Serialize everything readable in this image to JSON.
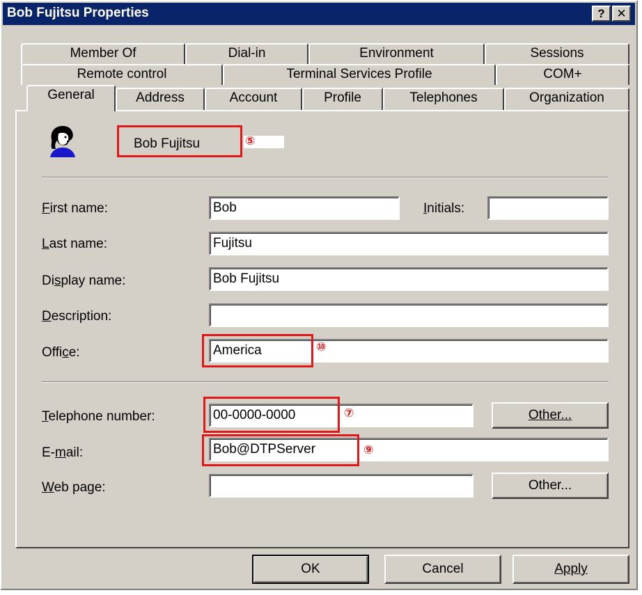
{
  "window": {
    "title": "Bob Fujitsu Properties",
    "help_label": "?",
    "close_label": "✕"
  },
  "tabs": {
    "row1": [
      "Member Of",
      "Dial-in",
      "Environment",
      "Sessions"
    ],
    "row2": [
      "Remote control",
      "Terminal Services Profile",
      "COM+"
    ],
    "row3": [
      "General",
      "Address",
      "Account",
      "Profile",
      "Telephones",
      "Organization"
    ],
    "active": "General"
  },
  "general": {
    "user_icon": "user-icon",
    "display_name": "Bob Fujitsu",
    "fields": {
      "first_name": {
        "label": "First name:",
        "value": "Bob"
      },
      "initials": {
        "label": "Initials:",
        "value": ""
      },
      "last_name": {
        "label": "Last name:",
        "value": "Fujitsu"
      },
      "display_name": {
        "label": "Display name:",
        "value": "Bob Fujitsu"
      },
      "description": {
        "label": "Description:",
        "value": ""
      },
      "office": {
        "label": "Office:",
        "value": "America"
      },
      "telephone": {
        "label": "Telephone number:",
        "value": "00-0000-0000"
      },
      "email": {
        "label": "E-mail:",
        "value": "Bob@DTPServer"
      },
      "web_page": {
        "label": "Web page:",
        "value": ""
      }
    },
    "other_button_1": "Other...",
    "other_button_2": "Other..."
  },
  "annotations": {
    "name": "⑤",
    "office": "⑩",
    "telephone": "⑦",
    "email": "⑨",
    "color": "#e01818"
  },
  "buttons": {
    "ok": "OK",
    "cancel": "Cancel",
    "apply": "Apply"
  }
}
